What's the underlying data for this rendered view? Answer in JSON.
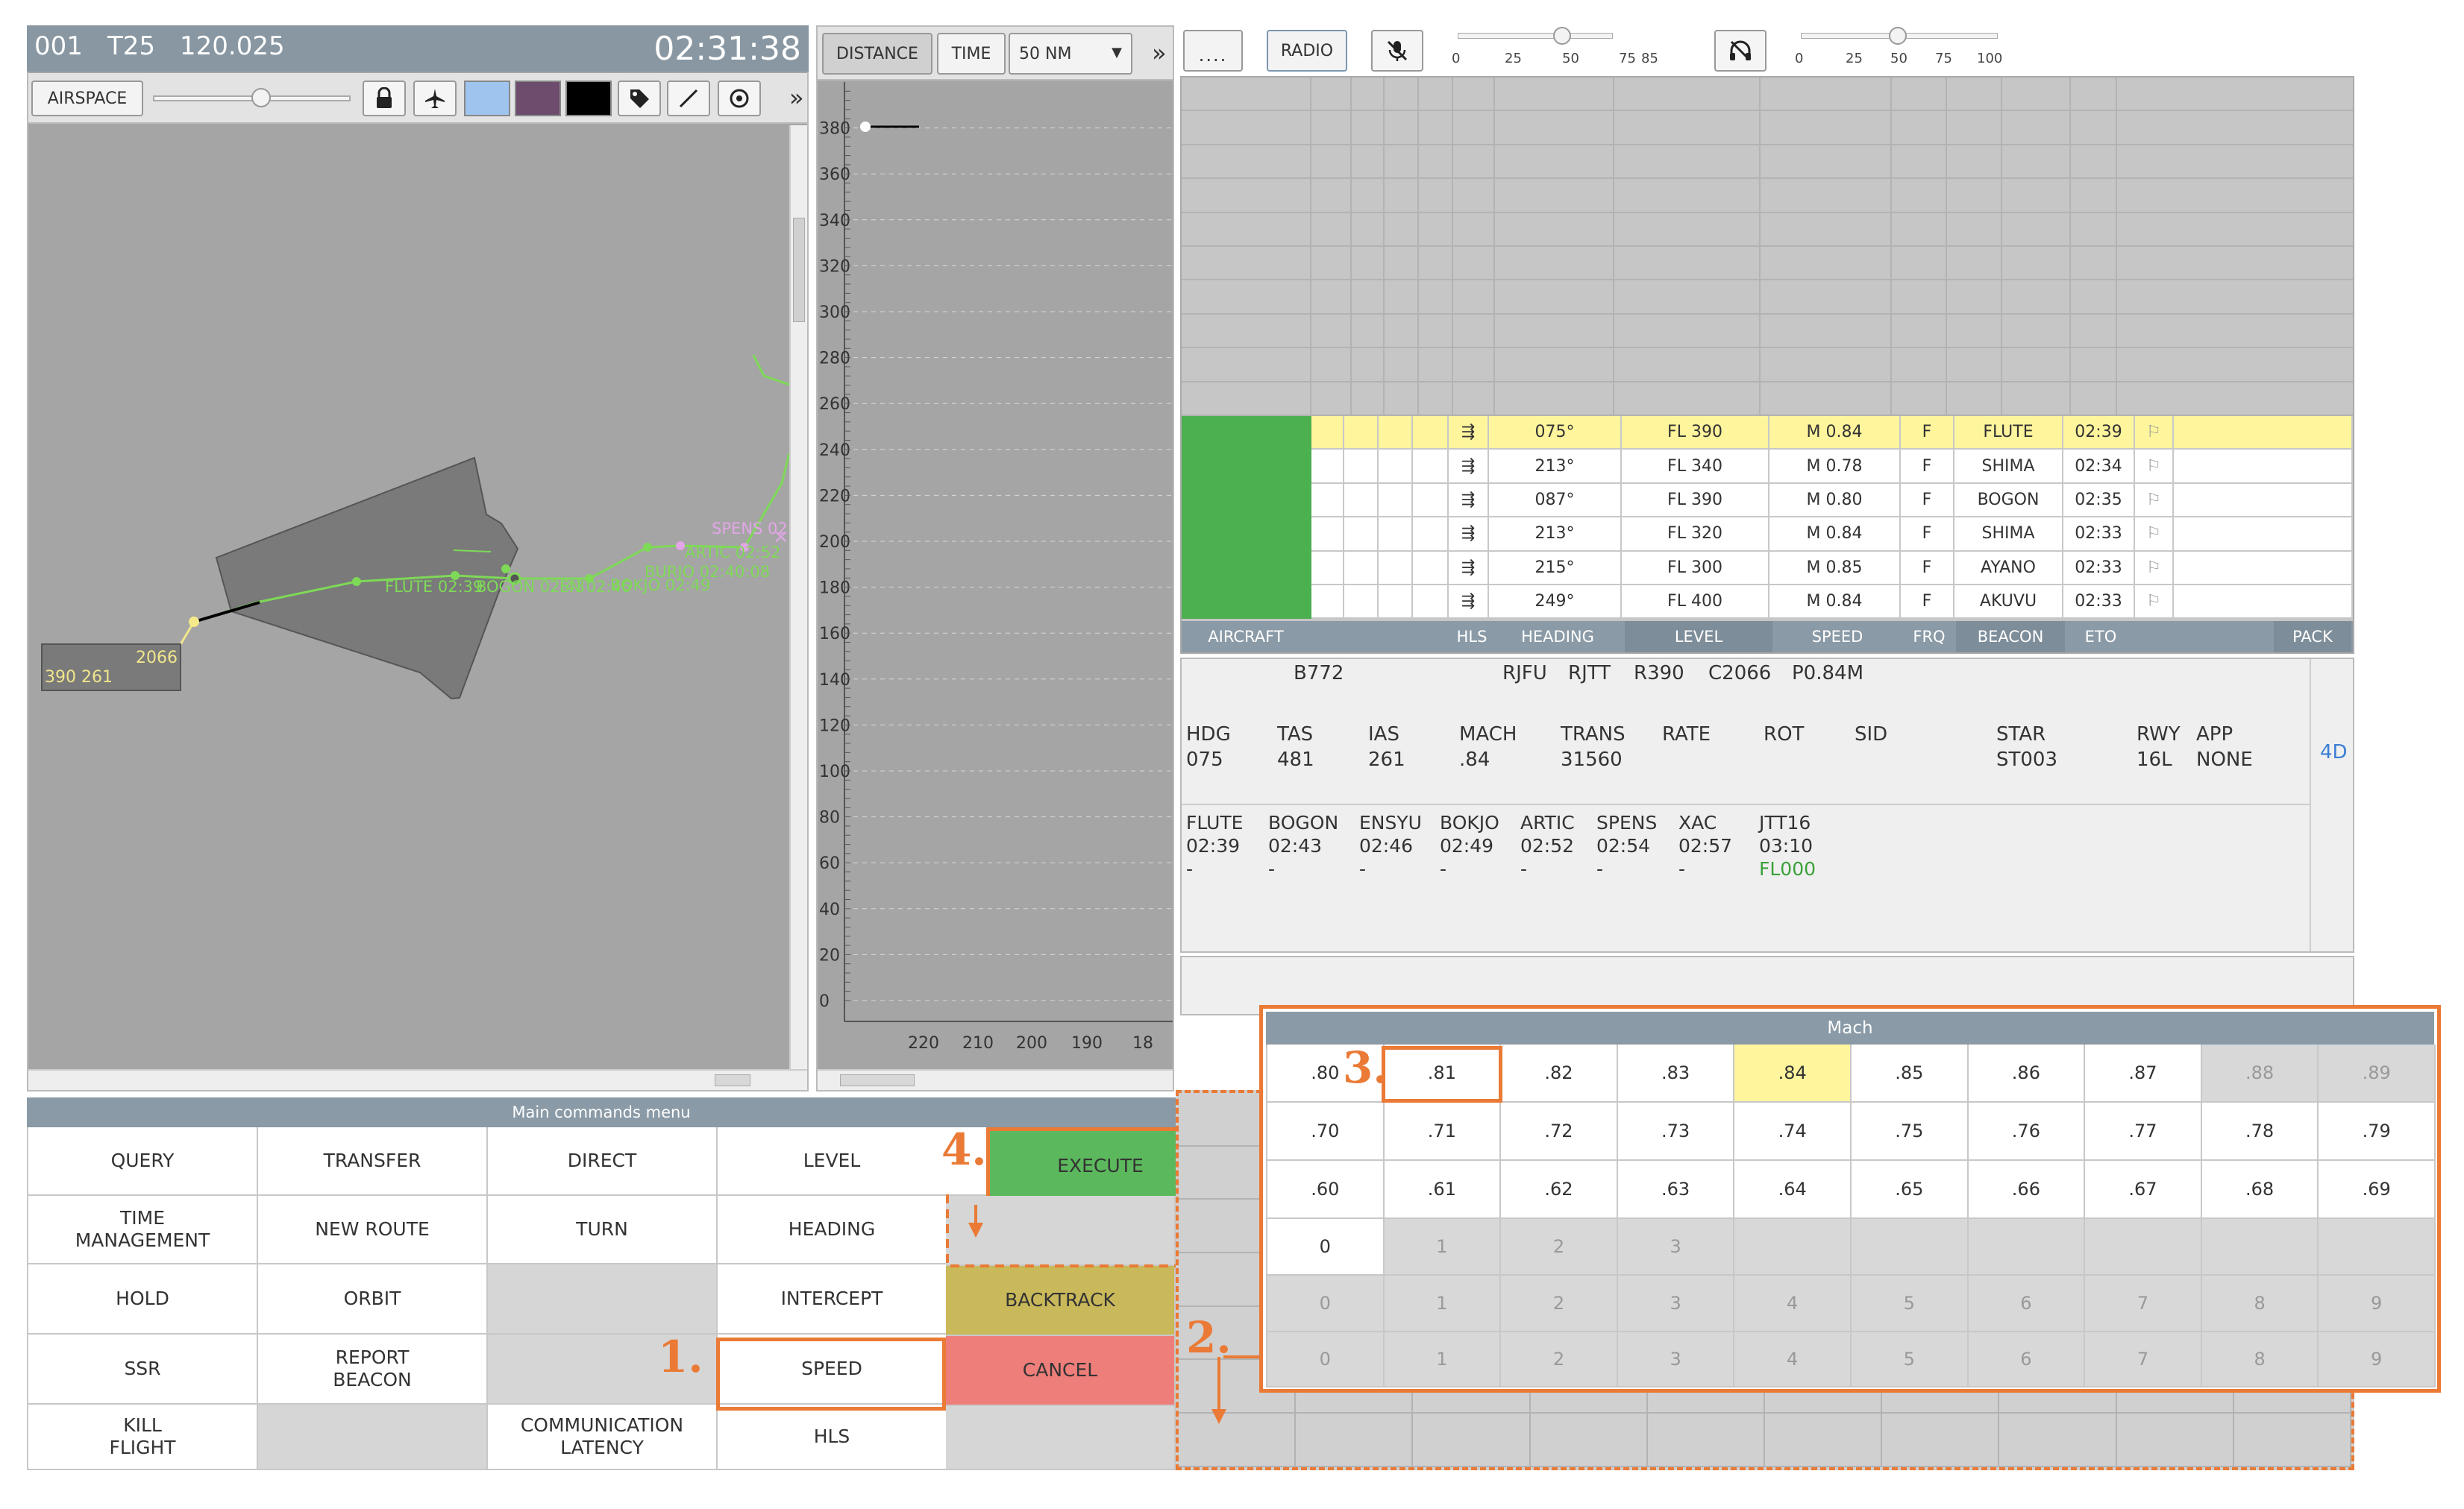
{
  "radar": {
    "header": {
      "id": "001",
      "sector": "T25",
      "frequency": "120.025",
      "clock": "02:31:38"
    },
    "toolbar": {
      "airspace": "AIRSPACE",
      "more": "»"
    },
    "icons": [
      "lock-icon",
      "airplane-icon",
      "light-blue-swatch",
      "purple-swatch",
      "black-swatch",
      "tag-icon",
      "line-tool-icon",
      "target-icon"
    ],
    "colors": {
      "light_blue": "#9fc5ef",
      "purple": "#6e4c6e",
      "black": "#000000",
      "route_green": "#7ed957",
      "waypoint_pink": "#e2a6e6",
      "label_yellow": "#f0e68c"
    },
    "aircraft_tag": {
      "line1": "2066",
      "line2": "390 261"
    },
    "route_labels": [
      {
        "text": "FLUTE 02:39"
      },
      {
        "text": "BOGON 02:43"
      },
      {
        "text": "EN 02:46"
      },
      {
        "text": "BOKJO 02:49"
      },
      {
        "text": "ARTIC 02:52"
      },
      {
        "text": "BURJO 02:40:08"
      },
      {
        "text": "SPENS 02"
      }
    ]
  },
  "profile": {
    "tabs": {
      "distance": "DISTANCE",
      "time": "TIME",
      "range": "50 NM",
      "more": "»"
    },
    "y_ticks": [
      "380",
      "360",
      "340",
      "320",
      "300",
      "280",
      "260",
      "240",
      "220",
      "200",
      "180",
      "160",
      "140",
      "120",
      "100",
      "80",
      "60",
      "40",
      "20",
      "0"
    ],
    "x_ticks": [
      "220",
      "210",
      "200",
      "190",
      "18"
    ]
  },
  "topbar": {
    "dots": "....",
    "radio": "RADIO",
    "icons": [
      "mic-muted-icon",
      "headset-muted-icon"
    ],
    "slider1_ticks": [
      "0",
      "25",
      "50",
      "75",
      "85"
    ],
    "slider1_level": 50,
    "slider2_ticks": [
      "0",
      "25",
      "50",
      "75",
      "100"
    ],
    "slider2_level": 50
  },
  "strips": {
    "rows": [
      {
        "hls": "⇶",
        "heading": "075°",
        "level": "FL 390",
        "speed": "M 0.84",
        "frq": "F",
        "beacon": "FLUTE",
        "eto": "02:39",
        "flag": "⚐",
        "selected": true
      },
      {
        "hls": "⇶",
        "heading": "213°",
        "level": "FL 340",
        "speed": "M 0.78",
        "frq": "F",
        "beacon": "SHIMA",
        "eto": "02:34",
        "flag": "⚐",
        "selected": false
      },
      {
        "hls": "⇶",
        "heading": "087°",
        "level": "FL 390",
        "speed": "M 0.80",
        "frq": "F",
        "beacon": "BOGON",
        "eto": "02:35",
        "flag": "⚐",
        "selected": false
      },
      {
        "hls": "⇶",
        "heading": "213°",
        "level": "FL 320",
        "speed": "M 0.84",
        "frq": "F",
        "beacon": "SHIMA",
        "eto": "02:33",
        "flag": "⚐",
        "selected": false
      },
      {
        "hls": "⇶",
        "heading": "215°",
        "level": "FL 300",
        "speed": "M 0.85",
        "frq": "F",
        "beacon": "AYANO",
        "eto": "02:33",
        "flag": "⚐",
        "selected": false
      },
      {
        "hls": "⇶",
        "heading": "249°",
        "level": "FL 400",
        "speed": "M 0.84",
        "frq": "F",
        "beacon": "AKUVU",
        "eto": "02:33",
        "flag": "⚐",
        "selected": false
      }
    ],
    "headers": {
      "aircraft": "AIRCRAFT",
      "hls": "HLS",
      "heading": "HEADING",
      "level": "LEVEL",
      "speed": "SPEED",
      "frq": "FRQ",
      "beacon": "BEACON",
      "eto": "ETO",
      "pack": "PACK"
    }
  },
  "info": {
    "type": "B772",
    "dep": "RJFU",
    "arr": "RJTT",
    "rfl": "R390",
    "cfl": "C2066",
    "pspeed": "P0.84M",
    "labels": [
      "HDG",
      "TAS",
      "IAS",
      "MACH",
      "TRANS",
      "RATE",
      "ROT",
      "SID",
      "STAR",
      "RWY",
      "APP"
    ],
    "values": {
      "hdg": "075",
      "tas": "481",
      "ias": "261",
      "mach": ".84",
      "trans": "31560",
      "star": "ST003",
      "rwy": "16L",
      "app": "NONE"
    },
    "fourd": "4D",
    "waypoints": [
      {
        "name": "FLUTE",
        "time": "02:39",
        "fl": "-"
      },
      {
        "name": "BOGON",
        "time": "02:43",
        "fl": "-"
      },
      {
        "name": "ENSYU",
        "time": "02:46",
        "fl": "-"
      },
      {
        "name": "BOKJO",
        "time": "02:49",
        "fl": "-"
      },
      {
        "name": "ARTIC",
        "time": "02:52",
        "fl": "-"
      },
      {
        "name": "SPENS",
        "time": "02:54",
        "fl": "-"
      },
      {
        "name": "XAC",
        "time": "02:57",
        "fl": "-"
      },
      {
        "name": "JTT16",
        "time": "03:10",
        "fl": "FL000"
      }
    ]
  },
  "menu": {
    "title": "Main commands menu",
    "rows": [
      [
        "QUERY",
        "TRANSFER",
        "DIRECT",
        "LEVEL"
      ],
      [
        "TIME\nMANAGEMENT",
        "NEW ROUTE",
        "TURN",
        "HEADING"
      ],
      [
        "HOLD",
        "ORBIT",
        "",
        "INTERCEPT"
      ],
      [
        "SSR",
        "REPORT\nBEACON",
        "",
        "SPEED"
      ],
      [
        "KILL\nFLIGHT",
        "",
        "COMMUNICATION\nLATENCY",
        "HLS"
      ]
    ],
    "execute": "EXECUTE",
    "backtrack": "BACKTRACK",
    "cancel": "CANCEL",
    "colors": {
      "execute": "#5cb85c",
      "backtrack": "#c9b95a",
      "cancel": "#ee7e7a"
    }
  },
  "mach_popup": {
    "title": "Mach",
    "rows": [
      [
        ".80",
        ".81",
        ".82",
        ".83",
        ".84",
        ".85",
        ".86",
        ".87",
        ".88",
        ".89"
      ],
      [
        ".70",
        ".71",
        ".72",
        ".73",
        ".74",
        ".75",
        ".76",
        ".77",
        ".78",
        ".79"
      ],
      [
        ".60",
        ".61",
        ".62",
        ".63",
        ".64",
        ".65",
        ".66",
        ".67",
        ".68",
        ".69"
      ],
      [
        "0",
        "1",
        "2",
        "3",
        "",
        "",
        "",
        "",
        "",
        ""
      ],
      [
        "0",
        "1",
        "2",
        "3",
        "4",
        "5",
        "6",
        "7",
        "8",
        "9"
      ],
      [
        "0",
        "1",
        "2",
        "3",
        "4",
        "5",
        "6",
        "7",
        "8",
        "9"
      ]
    ],
    "highlight": ".84"
  },
  "steps": [
    "1.",
    "2.",
    "3.",
    "4."
  ]
}
